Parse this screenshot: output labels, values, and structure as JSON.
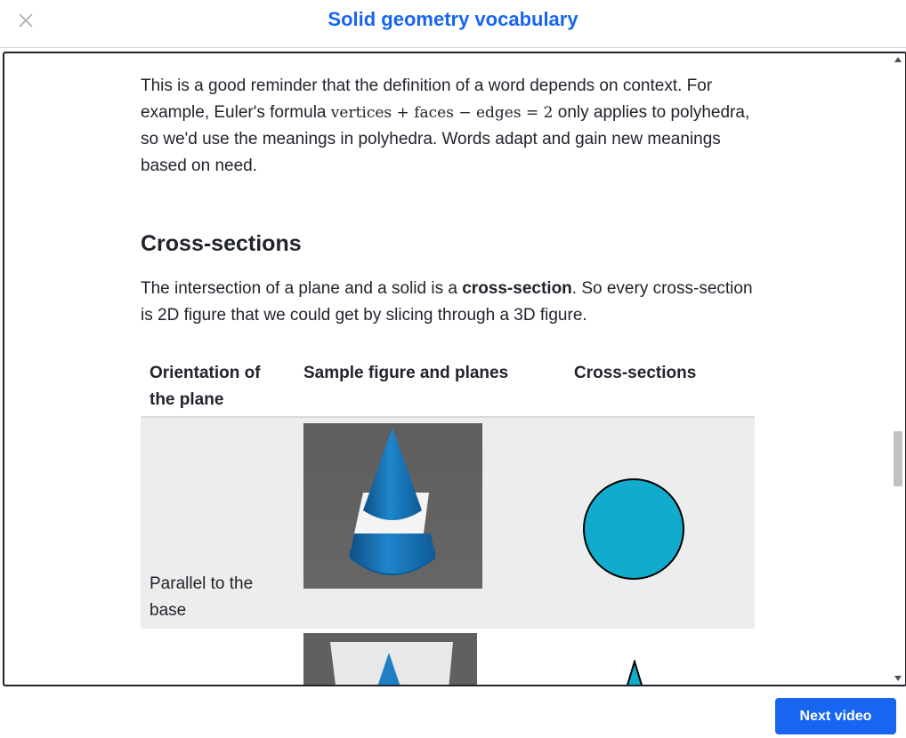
{
  "header": {
    "title": "Solid geometry vocabulary",
    "close_icon": "close-icon"
  },
  "article": {
    "para1_text_a": "This is a good reminder that the definition of a word depends on context. For example, Euler's formula ",
    "para1_math": "vertices + faces − edges = 2",
    "para1_text_b": " only applies to polyhedra, so we'd use the meanings in polyhedra. Words adapt and gain new meanings based on need.",
    "section_title": "Cross-sections",
    "para2_text_a": "The intersection of a plane and a solid is a ",
    "para2_bold": "cross-section",
    "para2_text_b": ". So every cross-section is 2D figure that we could get by slicing through a 3D figure."
  },
  "table": {
    "headers": [
      "Orientation of the plane",
      "Sample figure and planes",
      "Cross-sections"
    ],
    "rows": [
      {
        "orientation": "Parallel to the base"
      }
    ]
  },
  "colors": {
    "accent": "#1865f2",
    "cone_blue": "#1f7fc4",
    "cross_section_fill": "#11accd",
    "figure_bg": "#606060"
  },
  "footer": {
    "next_label": "Next video"
  }
}
